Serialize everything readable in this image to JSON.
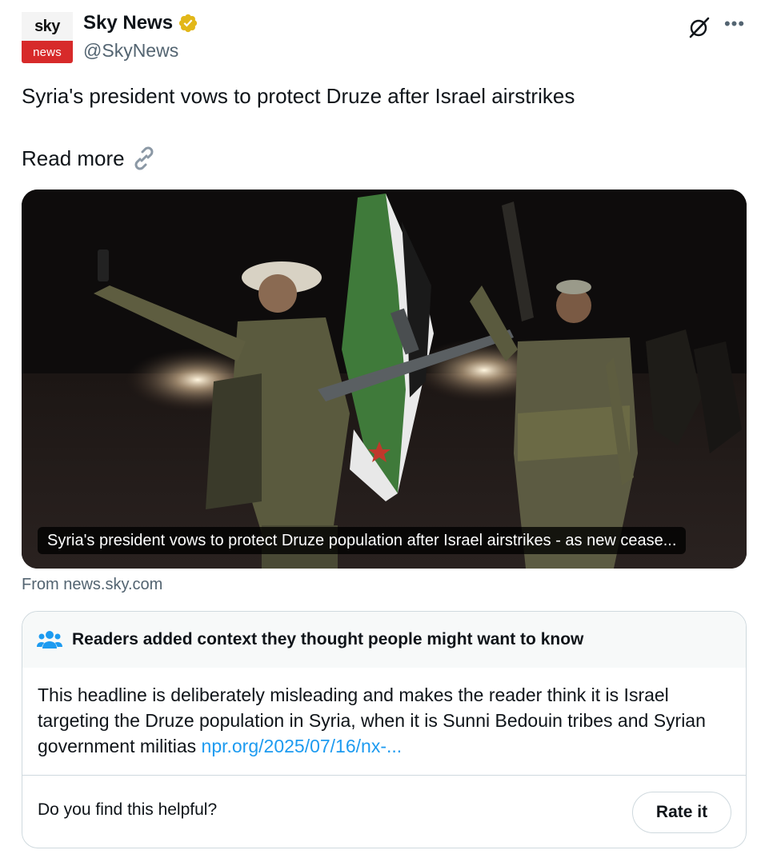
{
  "author": {
    "avatar_top_text": "sky",
    "avatar_bottom_text": "news",
    "display_name": "Sky News",
    "handle": "@SkyNews",
    "verified_color": "#e2b719"
  },
  "tweet": {
    "text": "Syria's president vows to protect Druze after Israel airstrikes",
    "read_more": "Read more"
  },
  "media": {
    "caption": "Syria's president vows to protect Druze population after Israel airstrikes - as new cease...",
    "source": "From news.sky.com"
  },
  "community_note": {
    "title": "Readers added context they thought people might want to know",
    "body": "This headline is deliberately misleading and makes the reader think it is Israel targeting the Druze population in Syria, when it is Sunni Bedouin tribes and Syrian government militias ",
    "link": "npr.org/2025/07/16/nx-...",
    "link_color": "#1d9bf0",
    "helpful_prompt": "Do you find this helpful?",
    "rate_button": "Rate it"
  },
  "icons": {
    "grok": "grok-icon",
    "more": "more-icon",
    "link": "link-icon",
    "people": "people-icon",
    "verified": "verified-badge-icon"
  }
}
